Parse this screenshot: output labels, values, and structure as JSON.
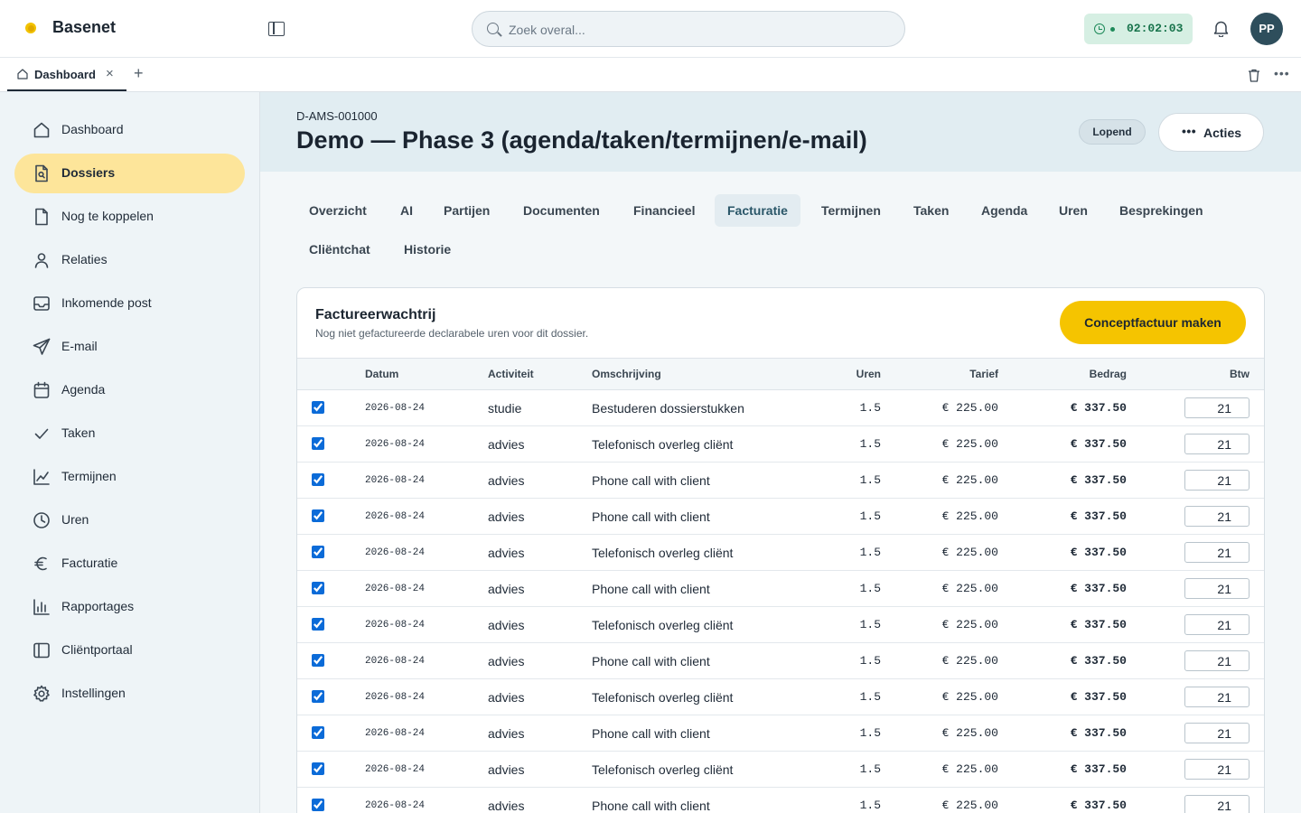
{
  "app": {
    "brand": "Basenet"
  },
  "search": {
    "placeholder": "Zoek overal..."
  },
  "timer": {
    "value": "02:02:03"
  },
  "user": {
    "initials": "PP"
  },
  "tabs": {
    "open": [
      {
        "label": "Dashboard"
      }
    ]
  },
  "sidebar": {
    "items": [
      {
        "label": "Dashboard",
        "icon": "home-icon",
        "active": false
      },
      {
        "label": "Dossiers",
        "icon": "file-icon",
        "active": true
      },
      {
        "label": "Nog te koppelen",
        "icon": "document-icon",
        "active": false
      },
      {
        "label": "Relaties",
        "icon": "user-icon",
        "active": false
      },
      {
        "label": "Inkomende post",
        "icon": "inbox-icon",
        "active": false
      },
      {
        "label": "E-mail",
        "icon": "send-icon",
        "active": false
      },
      {
        "label": "Agenda",
        "icon": "calendar-icon",
        "active": false
      },
      {
        "label": "Taken",
        "icon": "check-icon",
        "active": false
      },
      {
        "label": "Termijnen",
        "icon": "line-chart-icon",
        "active": false
      },
      {
        "label": "Uren",
        "icon": "clock-icon",
        "active": false
      },
      {
        "label": "Facturatie",
        "icon": "euro-icon",
        "active": false
      },
      {
        "label": "Rapportages",
        "icon": "bar-chart-icon",
        "active": false
      },
      {
        "label": "Cliëntportaal",
        "icon": "panel-icon",
        "active": false
      },
      {
        "label": "Instellingen",
        "icon": "gear-icon",
        "active": false
      }
    ]
  },
  "dossier": {
    "code": "D-AMS-001000",
    "title": "Demo — Phase 3 (agenda/taken/termijnen/e-mail)",
    "status": "Lopend",
    "actions_label": "Acties"
  },
  "section_tabs": [
    {
      "label": "Overzicht"
    },
    {
      "label": "AI"
    },
    {
      "label": "Partijen"
    },
    {
      "label": "Documenten"
    },
    {
      "label": "Financieel"
    },
    {
      "label": "Facturatie",
      "active": true
    },
    {
      "label": "Termijnen"
    },
    {
      "label": "Taken"
    },
    {
      "label": "Agenda"
    },
    {
      "label": "Uren"
    },
    {
      "label": "Besprekingen"
    },
    {
      "label": "Cliëntchat"
    },
    {
      "label": "Historie"
    }
  ],
  "queue": {
    "title": "Factureerwachtrij",
    "subtitle": "Nog niet gefactureerde declarabele uren voor dit dossier.",
    "button": "Conceptfactuur maken",
    "columns": {
      "datum": "Datum",
      "activiteit": "Activiteit",
      "omschrijving": "Omschrijving",
      "uren": "Uren",
      "tarief": "Tarief",
      "bedrag": "Bedrag",
      "btw": "Btw"
    },
    "rows": [
      {
        "checked": true,
        "datum": "2026-08-24",
        "activiteit": "studie",
        "omschrijving": "Bestuderen dossierstukken",
        "uren": "1.5",
        "tarief": "€ 225.00",
        "bedrag": "€ 337.50",
        "btw": "21"
      },
      {
        "checked": true,
        "datum": "2026-08-24",
        "activiteit": "advies",
        "omschrijving": "Telefonisch overleg cliënt",
        "uren": "1.5",
        "tarief": "€ 225.00",
        "bedrag": "€ 337.50",
        "btw": "21"
      },
      {
        "checked": true,
        "datum": "2026-08-24",
        "activiteit": "advies",
        "omschrijving": "Phone call with client",
        "uren": "1.5",
        "tarief": "€ 225.00",
        "bedrag": "€ 337.50",
        "btw": "21"
      },
      {
        "checked": true,
        "datum": "2026-08-24",
        "activiteit": "advies",
        "omschrijving": "Phone call with client",
        "uren": "1.5",
        "tarief": "€ 225.00",
        "bedrag": "€ 337.50",
        "btw": "21"
      },
      {
        "checked": true,
        "datum": "2026-08-24",
        "activiteit": "advies",
        "omschrijving": "Telefonisch overleg cliënt",
        "uren": "1.5",
        "tarief": "€ 225.00",
        "bedrag": "€ 337.50",
        "btw": "21"
      },
      {
        "checked": true,
        "datum": "2026-08-24",
        "activiteit": "advies",
        "omschrijving": "Phone call with client",
        "uren": "1.5",
        "tarief": "€ 225.00",
        "bedrag": "€ 337.50",
        "btw": "21"
      },
      {
        "checked": true,
        "datum": "2026-08-24",
        "activiteit": "advies",
        "omschrijving": "Telefonisch overleg cliënt",
        "uren": "1.5",
        "tarief": "€ 225.00",
        "bedrag": "€ 337.50",
        "btw": "21"
      },
      {
        "checked": true,
        "datum": "2026-08-24",
        "activiteit": "advies",
        "omschrijving": "Phone call with client",
        "uren": "1.5",
        "tarief": "€ 225.00",
        "bedrag": "€ 337.50",
        "btw": "21"
      },
      {
        "checked": true,
        "datum": "2026-08-24",
        "activiteit": "advies",
        "omschrijving": "Telefonisch overleg cliënt",
        "uren": "1.5",
        "tarief": "€ 225.00",
        "bedrag": "€ 337.50",
        "btw": "21"
      },
      {
        "checked": true,
        "datum": "2026-08-24",
        "activiteit": "advies",
        "omschrijving": "Phone call with client",
        "uren": "1.5",
        "tarief": "€ 225.00",
        "bedrag": "€ 337.50",
        "btw": "21"
      },
      {
        "checked": true,
        "datum": "2026-08-24",
        "activiteit": "advies",
        "omschrijving": "Telefonisch overleg cliënt",
        "uren": "1.5",
        "tarief": "€ 225.00",
        "bedrag": "€ 337.50",
        "btw": "21"
      },
      {
        "checked": true,
        "datum": "2026-08-24",
        "activiteit": "advies",
        "omschrijving": "Phone call with client",
        "uren": "1.5",
        "tarief": "€ 225.00",
        "bedrag": "€ 337.50",
        "btw": "21"
      }
    ]
  },
  "colors": {
    "accent": "#f5c400",
    "active_nav": "#fde59a",
    "timer_bg": "#d6efe3",
    "avatar": "#2e4e5c"
  }
}
